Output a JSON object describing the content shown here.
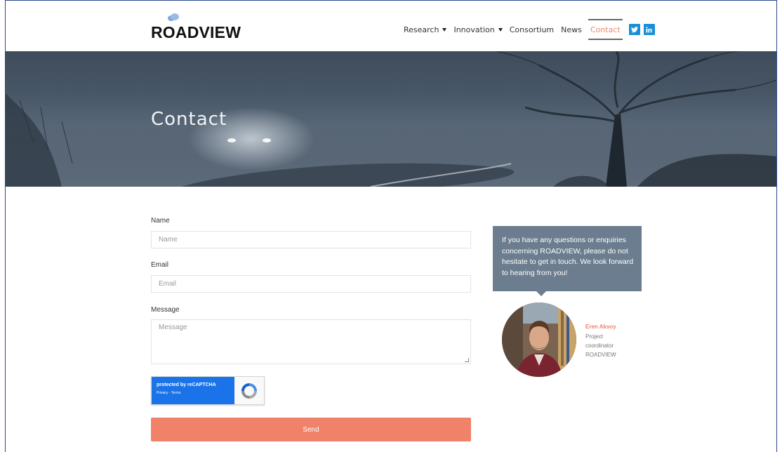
{
  "header": {
    "logo_text": "ROADVIEW",
    "nav": [
      {
        "label": "Research",
        "has_caret": true
      },
      {
        "label": "Innovation",
        "has_caret": true
      },
      {
        "label": "Consortium",
        "has_caret": false
      },
      {
        "label": "News",
        "has_caret": false
      },
      {
        "label": "Contact",
        "active": true
      }
    ],
    "social": [
      {
        "icon": "twitter-icon"
      },
      {
        "icon": "linkedin-icon"
      }
    ]
  },
  "hero": {
    "title": "Contact"
  },
  "form": {
    "name_label": "Name",
    "name_placeholder": "Name",
    "email_label": "Email",
    "email_placeholder": "Email",
    "message_label": "Message",
    "message_placeholder": "Message",
    "captcha_line1": "protected by reCAPTCHA",
    "captcha_line2": "Privacy - Terms",
    "send_label": "Send"
  },
  "contact_card": {
    "message": "If you have any questions or enquiries concerning ROADVIEW, please do not hesitate to get in touch. We look forward to hearing from you!",
    "name": "Eren Aksoy",
    "role_line1": "Project",
    "role_line2": "coordinator",
    "org": "ROADVIEW"
  },
  "colors": {
    "accent": "#f0826a",
    "bubble": "#6b7d8f",
    "social": "#1b8fd6"
  }
}
